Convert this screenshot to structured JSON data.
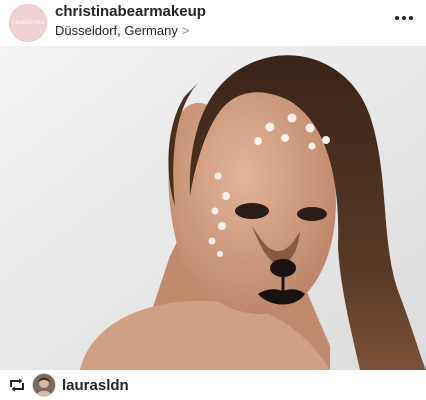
{
  "post": {
    "username": "christinabearmakeup",
    "location": "Düsseldorf, Germany",
    "location_chevron": ">",
    "avatar_mark": "CHRISTINA"
  },
  "footer": {
    "repost_user": "laurasldn"
  },
  "colors": {
    "text": "#262626",
    "avatar_bg": "#f0d4d4",
    "photo_bg": "#efefef"
  },
  "icons": {
    "more": "more-horizontal-icon",
    "repost": "repost-icon",
    "chevron": "chevron-right-icon"
  }
}
